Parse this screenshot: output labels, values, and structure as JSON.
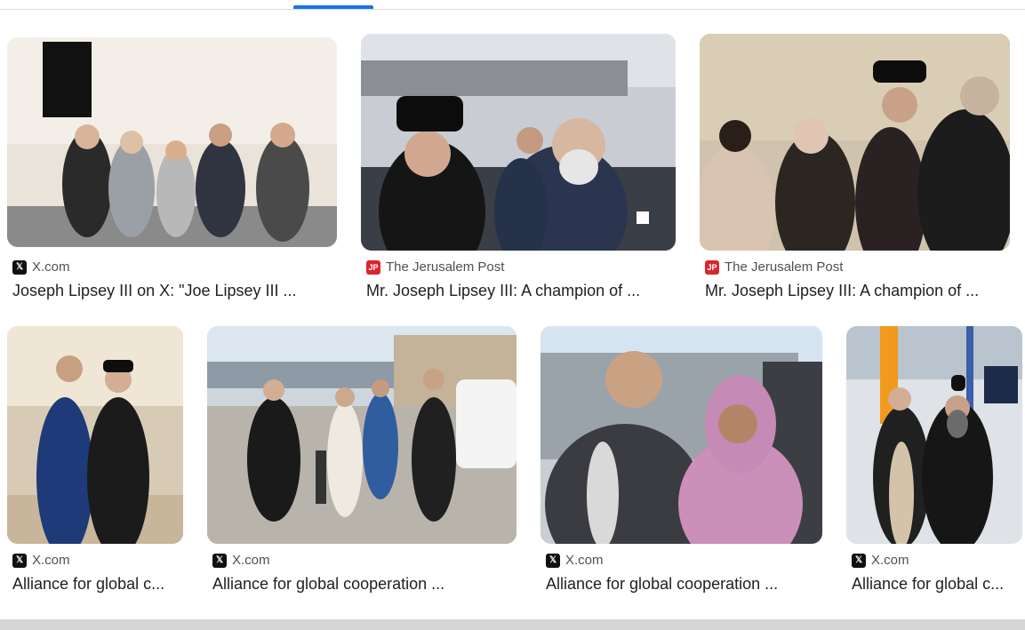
{
  "tabs": {
    "active_indicator": true
  },
  "results": [
    {
      "source": "X.com",
      "source_icon": "x-logo-icon",
      "title": "Joseph Lipsey III on X: \"Joe Lipsey III ..."
    },
    {
      "source": "The Jerusalem Post",
      "source_icon": "jp-logo-icon",
      "title": "Mr. Joseph Lipsey III: A champion of ..."
    },
    {
      "source": "The Jerusalem Post",
      "source_icon": "jp-logo-icon",
      "title": "Mr. Joseph Lipsey III: A champion of ..."
    },
    {
      "source": "X.com",
      "source_icon": "x-logo-icon",
      "title": "Alliance for global c..."
    },
    {
      "source": "X.com",
      "source_icon": "x-logo-icon",
      "title": "Alliance for global cooperation ..."
    },
    {
      "source": "X.com",
      "source_icon": "x-logo-icon",
      "title": "Alliance for global cooperation ..."
    },
    {
      "source": "X.com",
      "source_icon": "x-logo-icon",
      "title": "Alliance for global c..."
    }
  ],
  "colors": {
    "accent": "#1a73e8",
    "title_text": "#202124",
    "source_text": "#4d5156"
  }
}
